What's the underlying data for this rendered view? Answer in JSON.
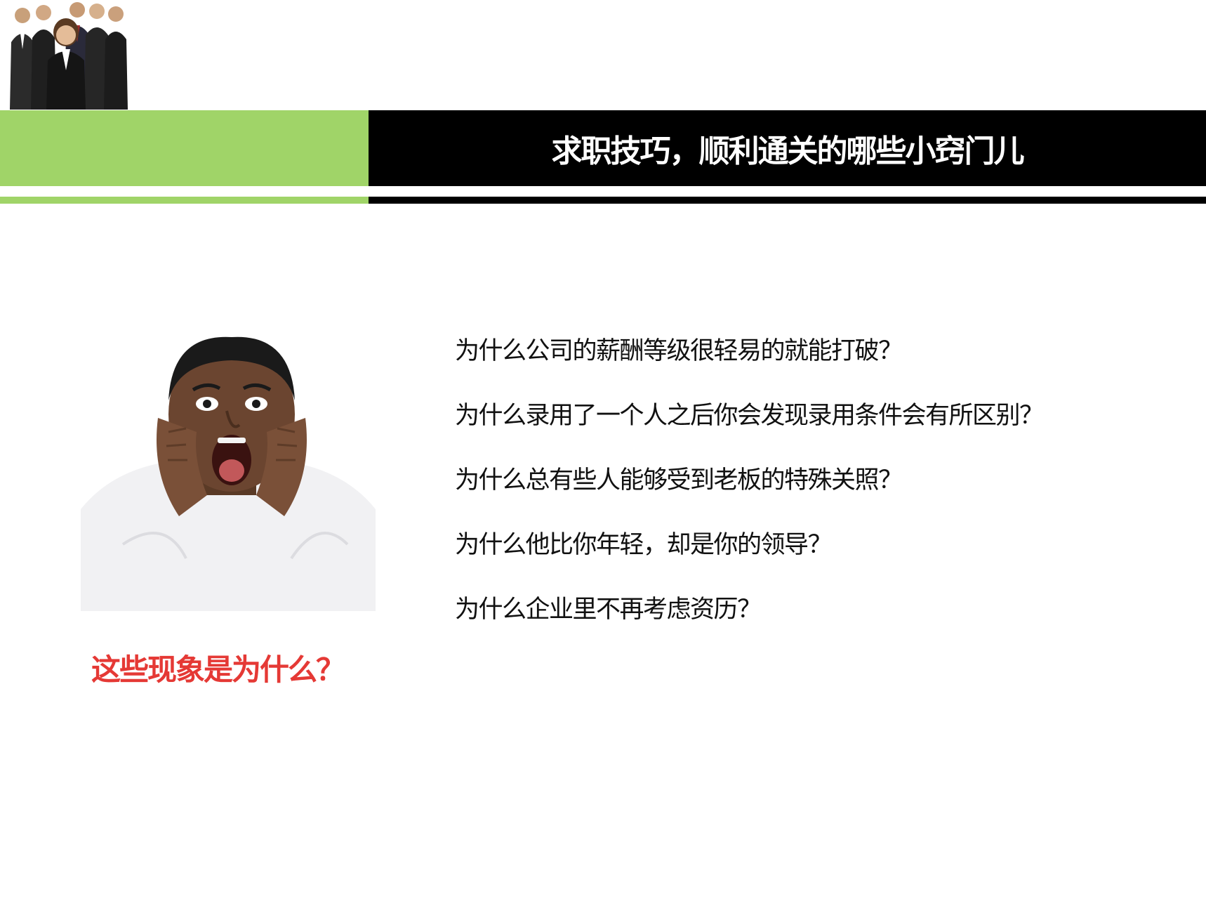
{
  "header": {
    "title": "求职技巧，顺利通关的哪些小窍门儿"
  },
  "questions": [
    "为什么公司的薪酬等级很轻易的就能打破？",
    "为什么录用了一个人之后你会发现录用条件会有所区别？",
    "为什么总有些人能够受到老板的特殊关照？",
    "为什么他比你年轻，却是你的领导？",
    "为什么企业里不再考虑资历？"
  ],
  "caption": "这些现象是为什么？",
  "colors": {
    "accent_green": "#a0d468",
    "band_black": "#000000",
    "caption_red": "#e53935"
  }
}
